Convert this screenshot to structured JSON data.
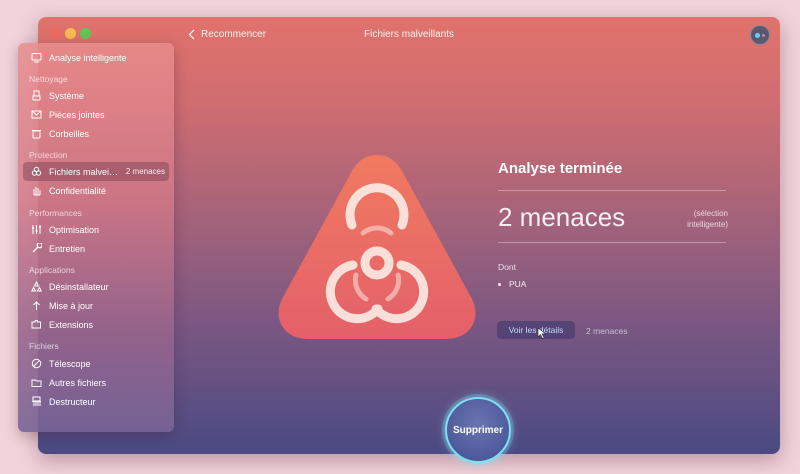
{
  "window": {
    "title": "Fichiers malveillants",
    "back_label": "Recommencer"
  },
  "sidebar": {
    "top_item": {
      "label": "Analyse intelligente",
      "icon": "monitor-icon"
    },
    "sections": [
      {
        "title": "Nettoyage",
        "items": [
          {
            "label": "Système",
            "icon": "brush-icon"
          },
          {
            "label": "Pièces jointes",
            "icon": "envelope-icon"
          },
          {
            "label": "Corbeilles",
            "icon": "trash-icon"
          }
        ]
      },
      {
        "title": "Protection",
        "items": [
          {
            "label": "Fichiers malvei…",
            "badge": "2 menaces",
            "icon": "biohazard-icon",
            "active": true
          },
          {
            "label": "Confidentialité",
            "icon": "hand-icon"
          }
        ]
      },
      {
        "title": "Performances",
        "items": [
          {
            "label": "Optimisation",
            "icon": "sliders-icon"
          },
          {
            "label": "Entretien",
            "icon": "wrench-icon"
          }
        ]
      },
      {
        "title": "Applications",
        "items": [
          {
            "label": "Désinstallateur",
            "icon": "apps-icon"
          },
          {
            "label": "Mise à jour",
            "icon": "update-icon"
          },
          {
            "label": "Extensions",
            "icon": "puzzle-icon"
          }
        ]
      },
      {
        "title": "Fichiers",
        "items": [
          {
            "label": "Télescope",
            "icon": "telescope-icon"
          },
          {
            "label": "Autres fichiers",
            "icon": "folder-icon"
          },
          {
            "label": "Destructeur",
            "icon": "shredder-icon"
          }
        ]
      }
    ]
  },
  "main": {
    "status_title": "Analyse terminée",
    "threats_count": "2 menaces",
    "selection_note": "(sélection intelligente)",
    "dont_label": "Dont",
    "threat_items": [
      "PUA"
    ],
    "details_button": "Voir les détails",
    "details_count": "2 menaces",
    "delete_button": "Supprimer"
  },
  "colors": {
    "accent_ring": "#7fe0f2",
    "hazard_fill": "#e56a5e"
  }
}
